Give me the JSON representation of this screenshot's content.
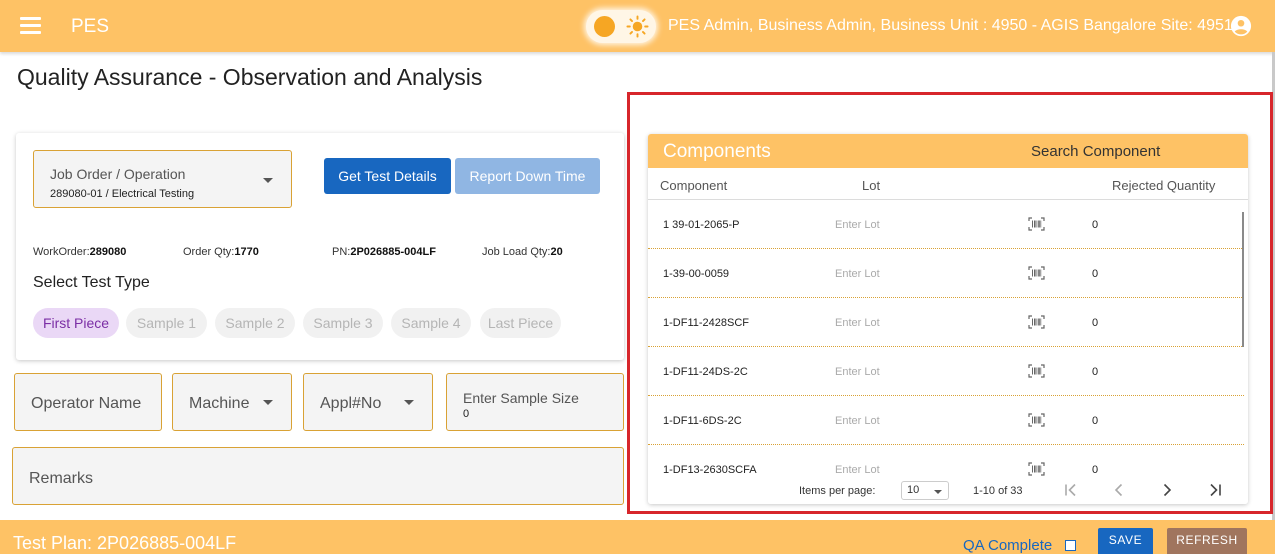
{
  "app": {
    "name": "PES",
    "user_info": "PES Admin, Business Admin, Business Unit : 4950 - AGIS Bangalore Site: 49510",
    "accent_color": "#fec265",
    "primary_color": "#1867c0"
  },
  "page": {
    "title": "Quality Assurance - Observation and Analysis"
  },
  "job": {
    "label": "Job Order / Operation",
    "value": "289080-01 / Electrical Testing",
    "get_test_details": "Get Test Details",
    "report_down_time": "Report Down Time"
  },
  "info": {
    "work_order_label": "WorkOrder:",
    "work_order": "289080",
    "order_qty_label": "Order Qty:",
    "order_qty": "1770",
    "pn_label": "PN:",
    "pn": "2P026885-004LF",
    "job_load_label": "Job Load Qty:",
    "job_load": "20"
  },
  "test_type": {
    "title": "Select Test Type",
    "selected": "First Piece",
    "options": [
      "First Piece",
      "Sample 1",
      "Sample 2",
      "Sample 3",
      "Sample 4",
      "Last Piece"
    ]
  },
  "form": {
    "operator_name": "Operator Name",
    "machine": "Machine",
    "appl_no": "Appl#No",
    "sample_size_label": "Enter Sample Size",
    "sample_size_value": "0",
    "remarks": "Remarks"
  },
  "components": {
    "title": "Components",
    "search_placeholder": "Search Component",
    "headers": {
      "component": "Component",
      "lot": "Lot",
      "rejected": "Rejected Quantity"
    },
    "rows": [
      {
        "name": "1 39-01-2065-P",
        "lot": "Enter Lot",
        "qty": "0"
      },
      {
        "name": "1-39-00-0059",
        "lot": "Enter Lot",
        "qty": "0"
      },
      {
        "name": "1-DF11-2428SCF",
        "lot": "Enter Lot",
        "qty": "0"
      },
      {
        "name": "1-DF11-24DS-2C",
        "lot": "Enter Lot",
        "qty": "0"
      },
      {
        "name": "1-DF11-6DS-2C",
        "lot": "Enter Lot",
        "qty": "0"
      },
      {
        "name": "1-DF13-2630SCFA",
        "lot": "Enter Lot",
        "qty": "0"
      }
    ],
    "pager": {
      "items_per_page_label": "Items per page:",
      "items_per_page": "10",
      "range": "1-10 of 33"
    }
  },
  "footer": {
    "test_plan": "Test Plan: 2P026885-004LF",
    "qa_complete": "QA Complete",
    "save": "SAVE",
    "refresh": "REFRESH"
  }
}
